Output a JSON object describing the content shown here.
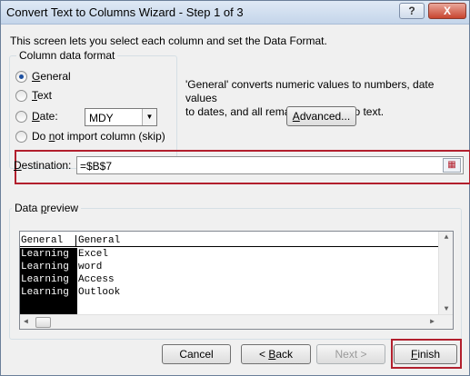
{
  "window": {
    "title": "Convert Text to Columns Wizard - Step 1 of 3",
    "help_label": "?",
    "close_label": "X"
  },
  "intro": "This screen lets you select each column and set the Data Format.",
  "column_data_format": {
    "legend": "Column data format",
    "options": [
      {
        "pre": "",
        "key": "G",
        "post": "eneral",
        "checked": true
      },
      {
        "pre": "",
        "key": "T",
        "post": "ext",
        "checked": false
      },
      {
        "pre": "",
        "key": "D",
        "post": "ate:",
        "checked": false
      },
      {
        "pre": "Do ",
        "key": "n",
        "post": "ot import column (skip)",
        "checked": false
      }
    ],
    "date_format_value": "MDY"
  },
  "description_line1": "'General' converts numeric values to numbers, date values",
  "description_line2": "to dates, and all remaining values to text.",
  "advanced_button": {
    "key": "A",
    "rest": "dvanced..."
  },
  "destination": {
    "label_key": "D",
    "label_rest": "estination:",
    "value": "=$B$7"
  },
  "data_preview": {
    "legend_pre": "Data ",
    "legend_key": "p",
    "legend_post": "review",
    "headers": [
      "General",
      "General"
    ],
    "rows": [
      [
        "Learning",
        "Excel"
      ],
      [
        "Learning",
        "word"
      ],
      [
        "Learning",
        "Access"
      ],
      [
        "Learning",
        "Outlook"
      ]
    ]
  },
  "buttons": {
    "cancel": "Cancel",
    "back_pre": "< ",
    "back_key": "B",
    "back_post": "ack",
    "next": "Next >",
    "finish_key": "F",
    "finish_rest": "inish"
  }
}
